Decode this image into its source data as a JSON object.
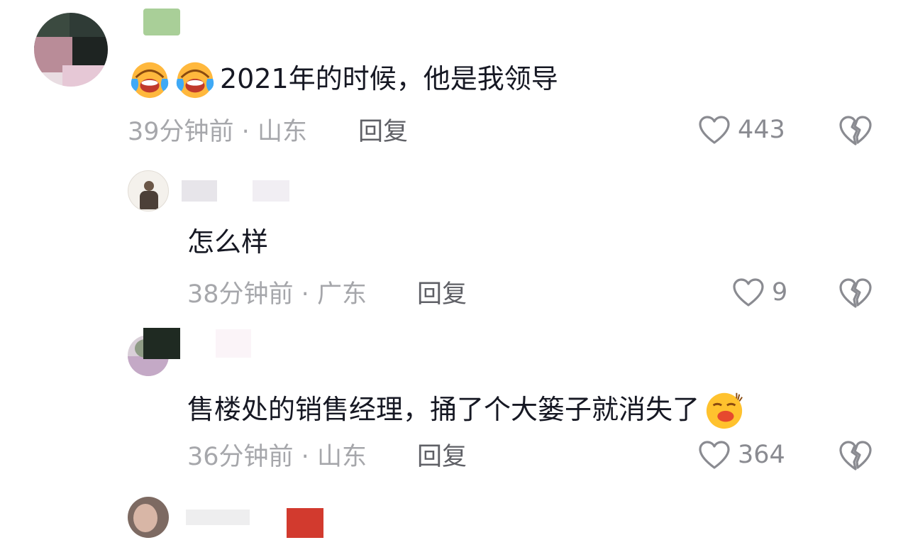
{
  "comments": [
    {
      "text": "2021年的时候，他是我领导",
      "emojis": [
        "crying-laughing-emoji",
        "crying-laughing-emoji"
      ],
      "time": "39分钟前",
      "location": "山东",
      "reply_label": "回复",
      "likes": "443"
    },
    {
      "text": "怎么样",
      "time": "38分钟前",
      "location": "广东",
      "reply_label": "回复",
      "likes": "9"
    },
    {
      "text": "售楼处的销售经理，捅了个大篓子就消失了",
      "trailing_emoji": "blushing-kiss-emoji",
      "time": "36分钟前",
      "location": "山东",
      "reply_label": "回复",
      "likes": "364"
    }
  ],
  "separator": " · ",
  "colors": {
    "text": "#161823",
    "meta": "#a6a7ab",
    "icon": "#8a8b91",
    "reply": "#5f6066"
  }
}
